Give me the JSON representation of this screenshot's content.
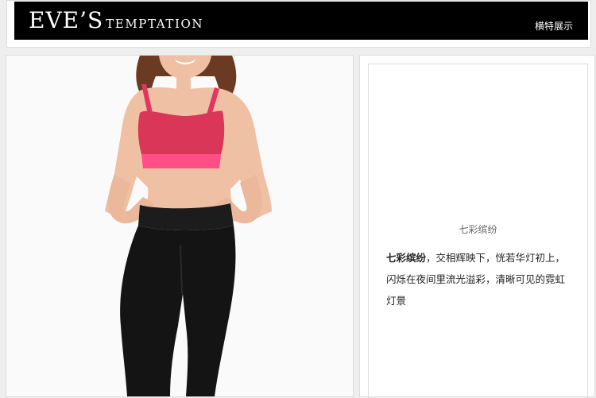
{
  "header": {
    "logo_main": "EVE’S",
    "logo_sub": "TEMPTATION",
    "nav_label": "横特展示"
  },
  "product": {
    "caption": "七彩缤纷",
    "description_lead": "七彩缤纷",
    "description_rest": "，交相辉映下，恍若华灯初上，闪烁在夜间里流光溢彩，清晰可见的霓虹灯景"
  },
  "colors": {
    "banner": "#000000",
    "panel_border": "#dddddd",
    "page_background": "#eeeeee",
    "bra": "#e0375f",
    "bra_band": "#ff4f86",
    "leggings": "#141414",
    "skin": "#f0c0a4",
    "hair": "#6b3a22"
  }
}
